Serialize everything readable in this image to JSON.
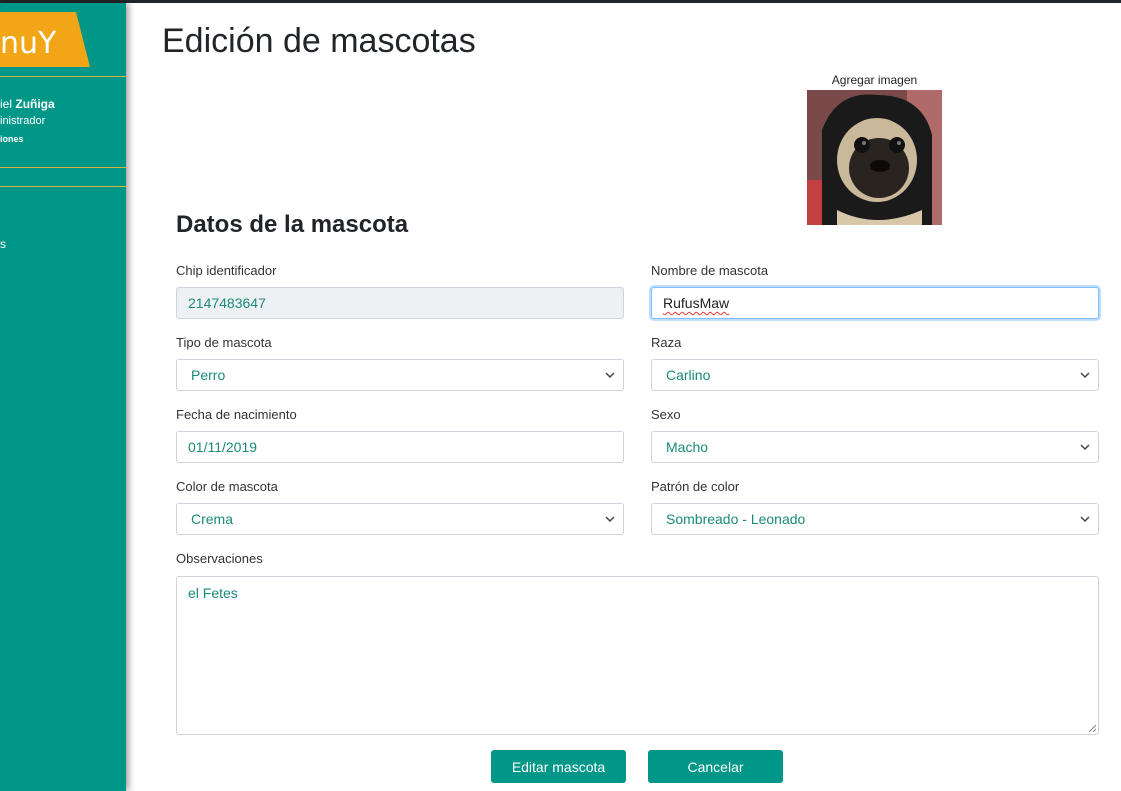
{
  "sidebar": {
    "logo_text": "nuY",
    "user_first": "iel",
    "user_last": "Zuñiga",
    "user_role": "inistrador",
    "user_extra": "iones",
    "nav_item": "s",
    "colors": {
      "background": "#009688",
      "logo": "#f2a516",
      "divider": "#d6b43c"
    }
  },
  "page": {
    "title": "Edición de mascotas",
    "image_label": "Agregar imagen",
    "section_title": "Datos de la mascota"
  },
  "form": {
    "chip": {
      "label": "Chip identificador",
      "value": "2147483647"
    },
    "name": {
      "label": "Nombre de mascota",
      "value": "RufusMaw"
    },
    "type": {
      "label": "Tipo de mascota",
      "value": "Perro"
    },
    "breed": {
      "label": "Raza",
      "value": "Carlino"
    },
    "birthdate": {
      "label": "Fecha de nacimiento",
      "value": "01/11/2019"
    },
    "sex": {
      "label": "Sexo",
      "value": "Macho"
    },
    "color": {
      "label": "Color de mascota",
      "value": "Crema"
    },
    "pattern": {
      "label": "Patrón de color",
      "value": "Sombreado - Leonado"
    },
    "notes": {
      "label": "Observaciones",
      "value": "el Fetes"
    }
  },
  "actions": {
    "edit_label": "Editar mascota",
    "cancel_label": "Cancelar"
  },
  "colors": {
    "accent": "#009688",
    "value_text": "#1a8a7a"
  }
}
